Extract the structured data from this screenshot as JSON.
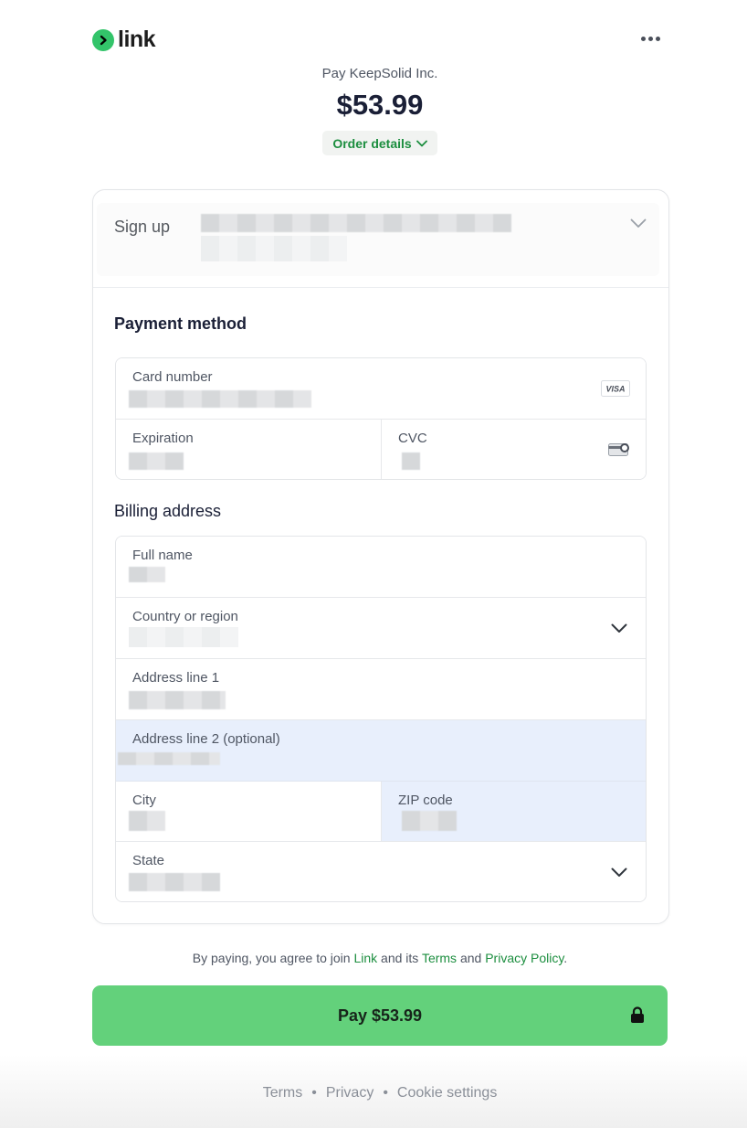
{
  "header": {
    "logo_text": "link",
    "merchant": "Pay KeepSolid Inc.",
    "amount": "$53.99",
    "order_details_label": "Order details"
  },
  "signup": {
    "label": "Sign up"
  },
  "payment": {
    "title": "Payment method",
    "card_number_label": "Card number",
    "card_brand": "VISA",
    "expiration_label": "Expiration",
    "cvc_label": "CVC"
  },
  "billing": {
    "title": "Billing address",
    "full_name_label": "Full name",
    "country_label": "Country or region",
    "address1_label": "Address line 1",
    "address2_label": "Address line 2 (optional)",
    "city_label": "City",
    "zip_label": "ZIP code",
    "state_label": "State"
  },
  "agreement": {
    "prefix": "By paying, you agree to join ",
    "link_text": "Link",
    "middle": " and its ",
    "terms_text": "Terms",
    "and_text": " and ",
    "privacy_text": "Privacy Policy",
    "suffix": "."
  },
  "pay_button": {
    "label": "Pay $53.99"
  },
  "footer": {
    "terms": "Terms",
    "privacy": "Privacy",
    "cookies": "Cookie settings",
    "separator": "•"
  },
  "colors": {
    "brand_green": "#33c46a",
    "pay_button": "#63d17b",
    "link_green": "#1c8e3f",
    "highlight_field": "#e8effc"
  },
  "icons": [
    "link-logo-icon",
    "more-icon",
    "chevron-down-icon",
    "visa-card-icon",
    "cvc-card-icon",
    "lock-icon"
  ]
}
